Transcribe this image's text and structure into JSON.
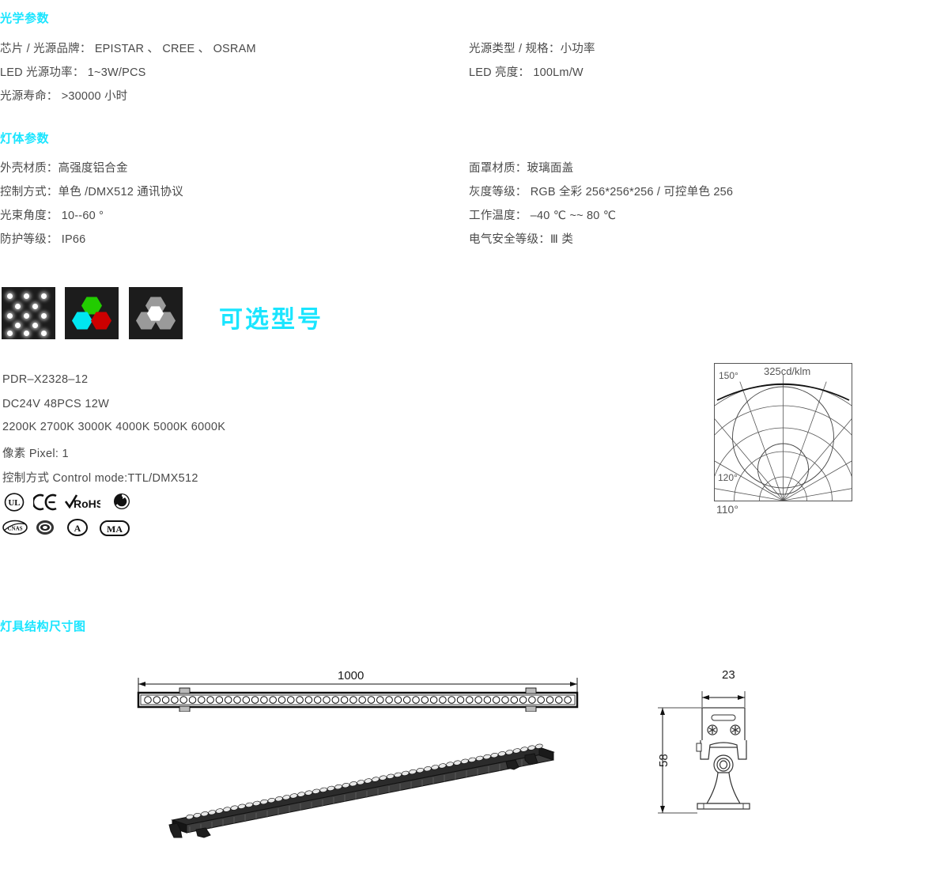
{
  "sections": {
    "optical": {
      "title": "光学参数",
      "left": [
        "芯片 / 光源品牌： EPISTAR 、 CREE 、 OSRAM",
        "LED 光源功率： 1~3W/PCS",
        "光源寿命： >30000 小时"
      ],
      "right": [
        "光源类型 / 规格：小功率",
        "LED 亮度： 100Lm/W"
      ]
    },
    "body": {
      "title": "灯体参数",
      "left": [
        "外壳材质：高强度铝合金",
        "控制方式：单色 /DMX512 通讯协议",
        "光束角度： 10--60 °",
        "防护等级： IP66"
      ],
      "right": [
        "面罩材质：玻璃面盖",
        "灰度等级： RGB 全彩 256*256*256 / 可控单色 256",
        "工作温度： –40 ℃ ~~ 80 ℃",
        "电气安全等级：Ⅲ 类"
      ]
    },
    "structure": {
      "title": "灯具结构尺寸图"
    }
  },
  "optional": {
    "heading": "可选型号",
    "icons": [
      {
        "name": "led-dot-array-icon",
        "label": "LED 点阵"
      },
      {
        "name": "rgb-hexagon-icon",
        "label": "RGB 全彩"
      },
      {
        "name": "white-hexagon-icon",
        "label": "单色白光"
      }
    ],
    "model_lines": [
      "PDR–X2328–12",
      "DC24V  48PCS   12W",
      "2200K   2700K   3000K   4000K   5000K   6000K",
      "像素 Pixel: 1",
      "控制方式 Control mode:TTL/DMX512"
    ],
    "certifications_row1": [
      "UL",
      "CE",
      "RoHS",
      "中国环保"
    ],
    "certifications_row2": [
      "CNAS",
      "CQC",
      "CCC",
      "MA"
    ]
  },
  "chart_data": {
    "type": "line",
    "title": "325cd/klm",
    "subtype": "polar-light-distribution",
    "peak_intensity": "325cd/klm",
    "angle_labels": [
      "150°",
      "120°",
      "110°"
    ],
    "beam_angle": "110°",
    "xlabel": "",
    "ylabel": "",
    "grid": true,
    "legend": "none",
    "radial_rings": [
      1,
      2,
      3,
      4
    ],
    "angular_spokes_deg": [
      -90,
      -60,
      -30,
      0,
      30,
      60,
      90,
      120,
      150
    ],
    "curve_values": [
      0.28,
      0.52,
      0.8,
      0.95,
      1.0,
      0.95,
      0.8,
      0.52,
      0.28
    ]
  },
  "drawings": {
    "top_view": {
      "name": "top-view-drawing",
      "dimension_label": "1000",
      "led_count": 48
    },
    "side_view": {
      "name": "side-view-drawing",
      "width_label": "23",
      "height_label": "58"
    },
    "perspective": {
      "name": "perspective-drawing"
    }
  },
  "colors": {
    "accent": "#1ae5ff",
    "text": "#4a4a4a",
    "icon_bg": "#1c1c1c",
    "hex_green": "#22cc00",
    "hex_cyan": "#00e6f0",
    "hex_red": "#cc0000",
    "hex_gray": "#9a9a9a",
    "hex_white": "#ffffff"
  }
}
